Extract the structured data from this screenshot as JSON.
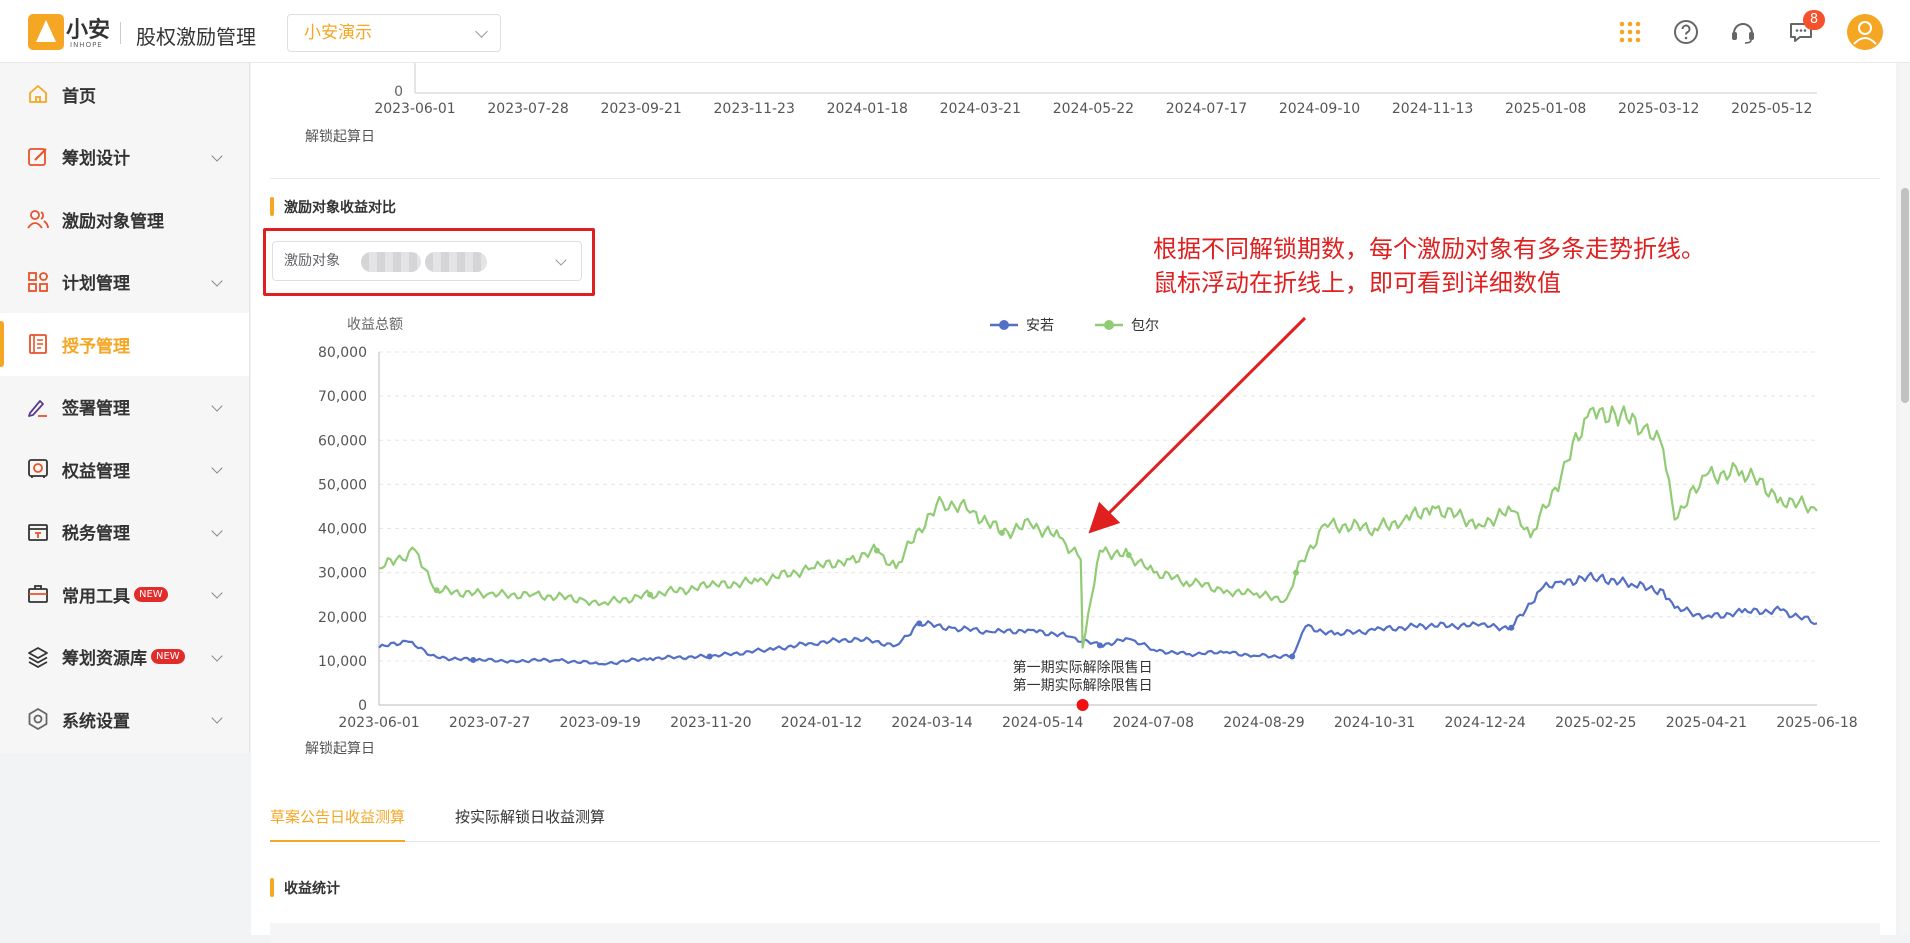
{
  "header": {
    "brand": "小安",
    "brand_sub": "INHOPE",
    "app_title": "股权激励管理",
    "company": "小安演示",
    "message_count": "8"
  },
  "sidebar": {
    "items": [
      {
        "label": "首页",
        "icon": "home-icon",
        "expandable": false,
        "new": false,
        "active": false
      },
      {
        "label": "筹划设计",
        "icon": "edit-icon",
        "expandable": true,
        "new": false,
        "active": false
      },
      {
        "label": "激励对象管理",
        "icon": "users-icon",
        "expandable": false,
        "new": false,
        "active": false
      },
      {
        "label": "计划管理",
        "icon": "grid-icon",
        "expandable": true,
        "new": false,
        "active": false
      },
      {
        "label": "授予管理",
        "icon": "book-icon",
        "expandable": false,
        "new": false,
        "active": true
      },
      {
        "label": "签署管理",
        "icon": "signature-icon",
        "expandable": true,
        "new": false,
        "active": false
      },
      {
        "label": "权益管理",
        "icon": "safe-icon",
        "expandable": true,
        "new": false,
        "active": false
      },
      {
        "label": "税务管理",
        "icon": "tax-icon",
        "expandable": true,
        "new": false,
        "active": false
      },
      {
        "label": "常用工具",
        "icon": "toolbox-icon",
        "expandable": true,
        "new": true,
        "active": false
      },
      {
        "label": "筹划资源库",
        "icon": "layers-icon",
        "expandable": true,
        "new": true,
        "active": false
      },
      {
        "label": "系统设置",
        "icon": "settings-icon",
        "expandable": true,
        "new": false,
        "active": false
      }
    ],
    "new_label": "NEW"
  },
  "top_chart": {
    "y_zero": "0",
    "xlabel": "解锁起算日",
    "ticks": [
      "2023-06-01",
      "2023-07-28",
      "2023-09-21",
      "2023-11-23",
      "2024-01-18",
      "2024-03-21",
      "2024-05-22",
      "2024-07-17",
      "2024-09-10",
      "2024-11-13",
      "2025-01-08",
      "2025-03-12",
      "2025-05-12"
    ]
  },
  "compare_section": {
    "title": "激励对象收益对比",
    "filter_label": "激励对象"
  },
  "annotation": {
    "line1": "根据不同解锁期数，每个激励对象有多条走势折线。",
    "line2": "鼠标浮动在折线上，即可看到详细数值",
    "color": "#e01f1f"
  },
  "chart_data": {
    "type": "line",
    "ylabel": "收益总额",
    "xlabel": "解锁起算日",
    "ylim": [
      0,
      80000
    ],
    "y_ticks": [
      0,
      10000,
      20000,
      30000,
      40000,
      50000,
      60000,
      70000,
      80000
    ],
    "y_tick_labels": [
      "0",
      "10,000",
      "20,000",
      "30,000",
      "40,000",
      "50,000",
      "60,000",
      "70,000",
      "80,000"
    ],
    "x_range": [
      "2023-06-01",
      "2025-06-18"
    ],
    "x_tick_labels": [
      "2023-06-01",
      "2023-07-27",
      "2023-09-19",
      "2023-11-20",
      "2024-01-12",
      "2024-03-14",
      "2024-05-14",
      "2024-07-08",
      "2024-08-29",
      "2024-10-31",
      "2024-12-24",
      "2025-02-25",
      "2025-04-21",
      "2025-06-18"
    ],
    "legend_position": "top-center",
    "grid": true,
    "series": [
      {
        "name": "安若",
        "color": "#5470c6",
        "x": [
          "2023-06-01",
          "2023-06-15",
          "2023-07-01",
          "2023-07-20",
          "2023-08-10",
          "2023-09-01",
          "2023-09-25",
          "2023-10-20",
          "2023-11-20",
          "2023-12-20",
          "2024-01-12",
          "2024-02-05",
          "2024-02-25",
          "2024-03-08",
          "2024-03-25",
          "2024-04-15",
          "2024-05-05",
          "2024-05-25",
          "2024-06-10",
          "2024-06-25",
          "2024-07-08",
          "2024-07-25",
          "2024-08-15",
          "2024-08-29",
          "2024-09-18",
          "2024-09-25",
          "2024-10-10",
          "2024-10-31",
          "2024-11-25",
          "2024-12-24",
          "2025-01-10",
          "2025-01-25",
          "2025-02-05",
          "2025-02-25",
          "2025-03-15",
          "2025-03-30",
          "2025-04-05",
          "2025-04-21",
          "2025-05-10",
          "2025-05-30",
          "2025-06-18"
        ],
        "y": [
          13000,
          14500,
          10800,
          10200,
          10000,
          10200,
          9300,
          10600,
          11000,
          12500,
          14000,
          15000,
          13500,
          18500,
          17500,
          16500,
          17000,
          15500,
          13500,
          15000,
          12500,
          11500,
          12000,
          11200,
          11000,
          17800,
          16000,
          17000,
          18000,
          18000,
          17500,
          26000,
          28000,
          29000,
          27000,
          26000,
          22000,
          20000,
          21000,
          21500,
          18500
        ]
      },
      {
        "name": "包尔",
        "color": "#91cc75",
        "x": [
          "2023-06-01",
          "2023-06-10",
          "2023-06-20",
          "2023-07-01",
          "2023-07-27",
          "2023-08-20",
          "2023-09-15",
          "2023-09-25",
          "2023-10-20",
          "2023-11-20",
          "2023-12-15",
          "2024-01-12",
          "2024-02-01",
          "2024-02-15",
          "2024-02-25",
          "2024-03-08",
          "2024-03-20",
          "2024-04-05",
          "2024-04-20",
          "2024-05-05",
          "2024-05-20",
          "2024-05-31",
          "2024-06-01",
          "2024-06-10",
          "2024-06-25",
          "2024-07-08",
          "2024-07-25",
          "2024-08-15",
          "2024-08-29",
          "2024-09-15",
          "2024-09-20",
          "2024-10-05",
          "2024-10-31",
          "2024-11-15",
          "2024-11-30",
          "2024-12-24",
          "2025-01-10",
          "2025-01-20",
          "2025-02-05",
          "2025-02-20",
          "2025-03-05",
          "2025-03-20",
          "2025-03-30",
          "2025-04-05",
          "2025-04-21",
          "2025-05-10",
          "2025-05-30",
          "2025-06-18"
        ],
        "y": [
          31000,
          33000,
          35000,
          26000,
          25000,
          25000,
          24000,
          23000,
          25000,
          27000,
          28000,
          31000,
          33000,
          35000,
          31000,
          40000,
          46000,
          44000,
          39000,
          41000,
          38000,
          33000,
          13000,
          35000,
          34000,
          30000,
          28000,
          26000,
          25000,
          24000,
          30000,
          41000,
          40000,
          42000,
          45000,
          41000,
          44000,
          38000,
          52000,
          67000,
          66000,
          63000,
          58000,
          42000,
          52000,
          53000,
          47000,
          44000
        ]
      }
    ],
    "annotation": {
      "label": "第一期实际解除限售日",
      "label2": "第一期实际解除限售日",
      "x": "2024-06-01"
    }
  },
  "tabs": [
    {
      "label": "草案公告日收益测算",
      "active": true
    },
    {
      "label": "按实际解锁日收益测算",
      "active": false
    }
  ],
  "stats_section": {
    "title": "收益统计"
  }
}
